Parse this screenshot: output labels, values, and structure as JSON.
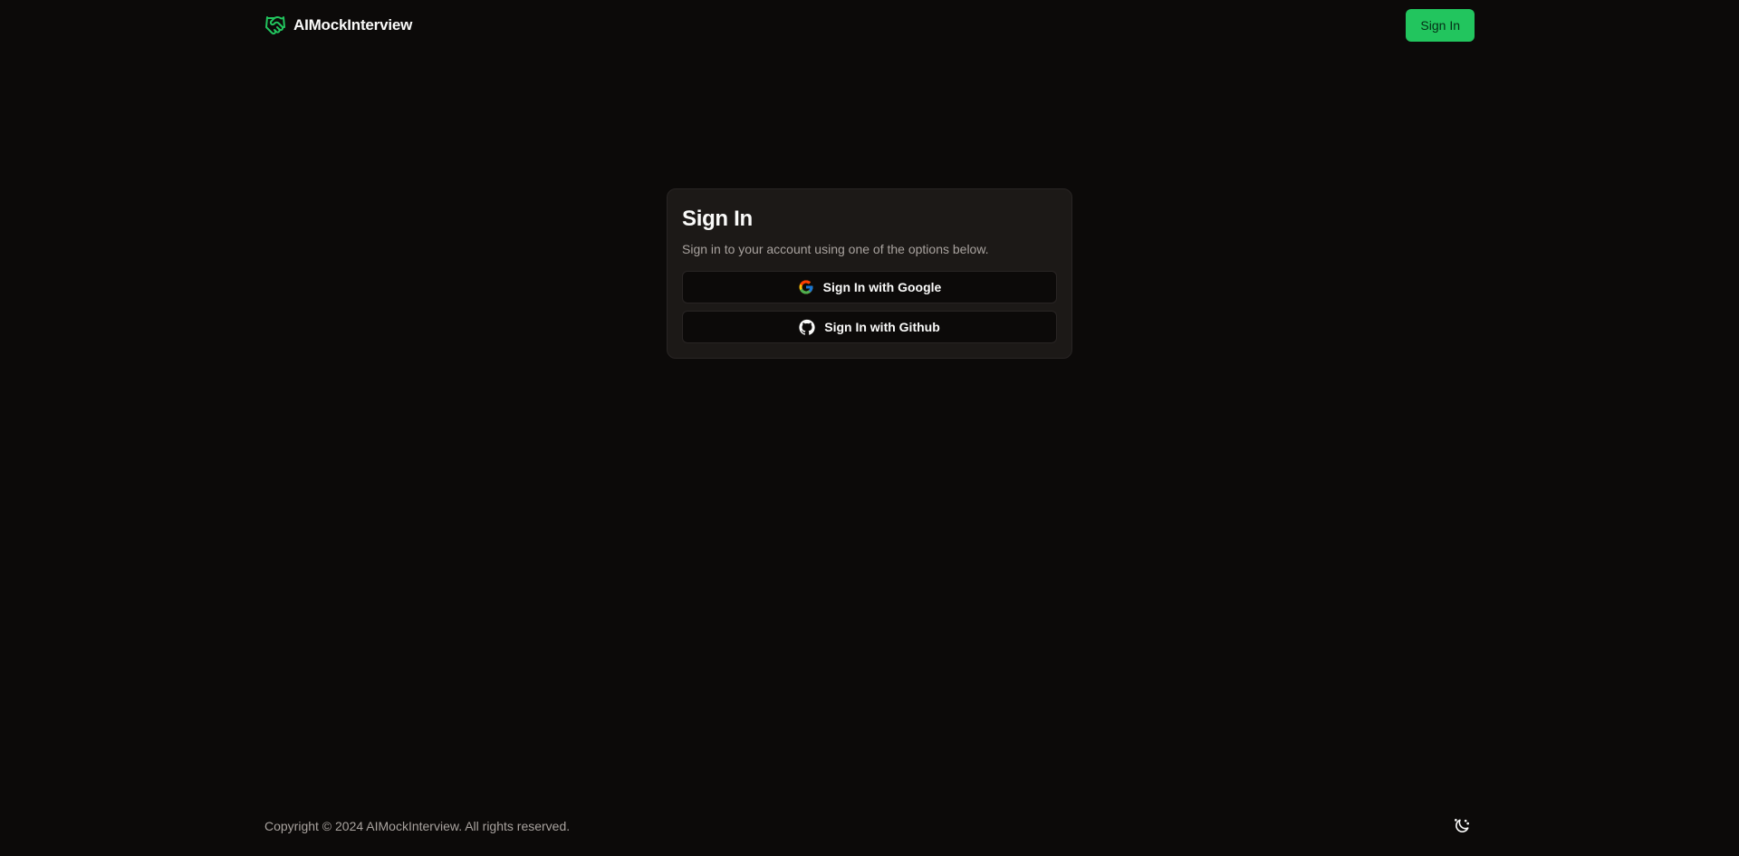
{
  "header": {
    "brand_name": "AIMockInterview",
    "brand_icon": "handshake-icon",
    "signin_label": "Sign In"
  },
  "card": {
    "title": "Sign In",
    "description": "Sign in to your account using one of the options below.",
    "google_button": {
      "label": "Sign In with Google",
      "icon": "google-icon"
    },
    "github_button": {
      "label": "Sign In with Github",
      "icon": "github-icon"
    }
  },
  "footer": {
    "copyright": "Copyright © 2024 AIMockInterview. All rights reserved.",
    "theme_toggle_icon": "moon-icon"
  },
  "colors": {
    "background": "#0c0a09",
    "card_background": "#1c1917",
    "accent": "#22c55e",
    "muted_text": "#a8a29e"
  }
}
